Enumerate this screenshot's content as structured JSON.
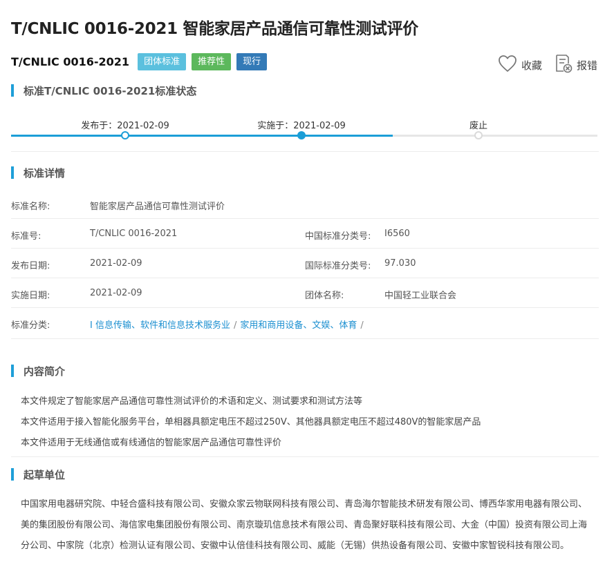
{
  "title": "T/CNLIC 0016-2021 智能家居产品通信可靠性测试评价",
  "code": "T/CNLIC 0016-2021",
  "badges": {
    "group": "团体标准",
    "recommended": "推荐性",
    "current": "现行"
  },
  "actions": {
    "favorite": "收藏",
    "report": "报错"
  },
  "status_section": {
    "title": "标准T/CNLIC 0016-2021标准状态",
    "published": "发布于：2021-02-09",
    "implemented": "实施于：2021-02-09",
    "abolished": "废止"
  },
  "details_section": {
    "title": "标准详情",
    "name_label": "标准名称:",
    "name_value": "智能家居产品通信可靠性测试评价",
    "number_label": "标准号:",
    "number_value": "T/CNLIC 0016-2021",
    "cn_class_label": "中国标准分类号:",
    "cn_class_value": "I6560",
    "pub_date_label": "发布日期:",
    "pub_date_value": "2021-02-09",
    "ics_label": "国际标准分类号:",
    "ics_value": "97.030",
    "impl_date_label": "实施日期:",
    "impl_date_value": "2021-02-09",
    "org_label": "团体名称:",
    "org_value": "中国轻工业联合会",
    "category_label": "标准分类:",
    "category_1": "I 信息传输、软件和信息技术服务业",
    "category_2": "家用和商用设备、文娱、体育",
    "separator": "/"
  },
  "intro_section": {
    "title": "内容简介",
    "lines": [
      "本文件规定了智能家居产品通信可靠性测试评价的术语和定义、测试要求和测试方法等",
      "本文件适用于接入智能化服务平台，单相器具额定电压不超过250V、其他器具额定电压不超过480V的智能家居产品",
      "本文件适用于无线通信或有线通信的智能家居产品通信可靠性评价"
    ]
  },
  "drafters_section": {
    "title": "起草单位",
    "text": "中国家用电器研究院、中轻合盛科技有限公司、安徽众家云物联网科技有限公司、青岛海尔智能技术研发有限公司、博西华家用电器有限公司、美的集团股份有限公司、海信家电集团股份有限公司、南京璇玑信息技术有限公司、青岛聚好联科技有限公司、大金（中国）投资有限公司上海分公司、中家院（北京）检测认证有限公司、安徽中认倍佳科技有限公司、威能（无锡）供热设备有限公司、安徽中家智锐科技有限公司。"
  },
  "colors": {
    "accent": "#1b9ed7",
    "badge_group": "#5bc0de",
    "badge_recommended": "#5cb85c",
    "badge_current": "#337ab7"
  }
}
